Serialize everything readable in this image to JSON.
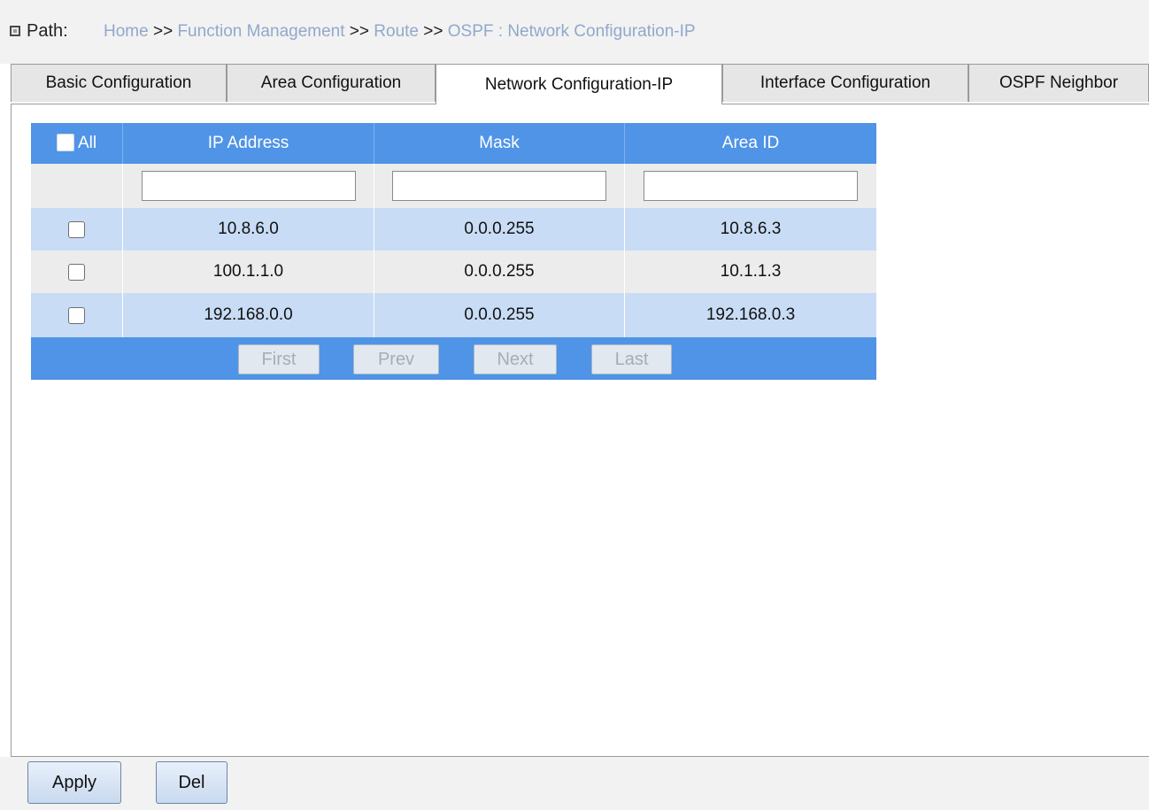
{
  "path": {
    "label": "Path:",
    "crumbs": [
      "Home",
      "Function Management",
      "Route",
      "OSPF"
    ],
    "separator": ">>",
    "current": "Network Configuration-IP",
    "current_separator": ":"
  },
  "tabs": [
    {
      "label": "Basic Configuration"
    },
    {
      "label": "Area Configuration"
    },
    {
      "label": "Network Configuration-IP",
      "active": true
    },
    {
      "label": "Interface Configuration"
    },
    {
      "label": "OSPF Neighbor"
    }
  ],
  "table": {
    "select_all_label": "All",
    "columns": [
      "IP Address",
      "Mask",
      "Area ID"
    ],
    "filters": {
      "ip": "",
      "mask": "",
      "area": ""
    },
    "rows": [
      {
        "ip": "10.8.6.0",
        "mask": "0.0.0.255",
        "area": "10.8.6.3"
      },
      {
        "ip": "100.1.1.0",
        "mask": "0.0.0.255",
        "area": "10.1.1.3"
      },
      {
        "ip": "192.168.0.0",
        "mask": "0.0.0.255",
        "area": "192.168.0.3"
      }
    ]
  },
  "pager": {
    "first": "First",
    "prev": "Prev",
    "next": "Next",
    "last": "Last"
  },
  "actions": {
    "apply": "Apply",
    "del": "Del"
  },
  "colors": {
    "header_blue": "#4f94e6",
    "row_blue": "#c8dcf5",
    "link": "#8fa9cc"
  }
}
